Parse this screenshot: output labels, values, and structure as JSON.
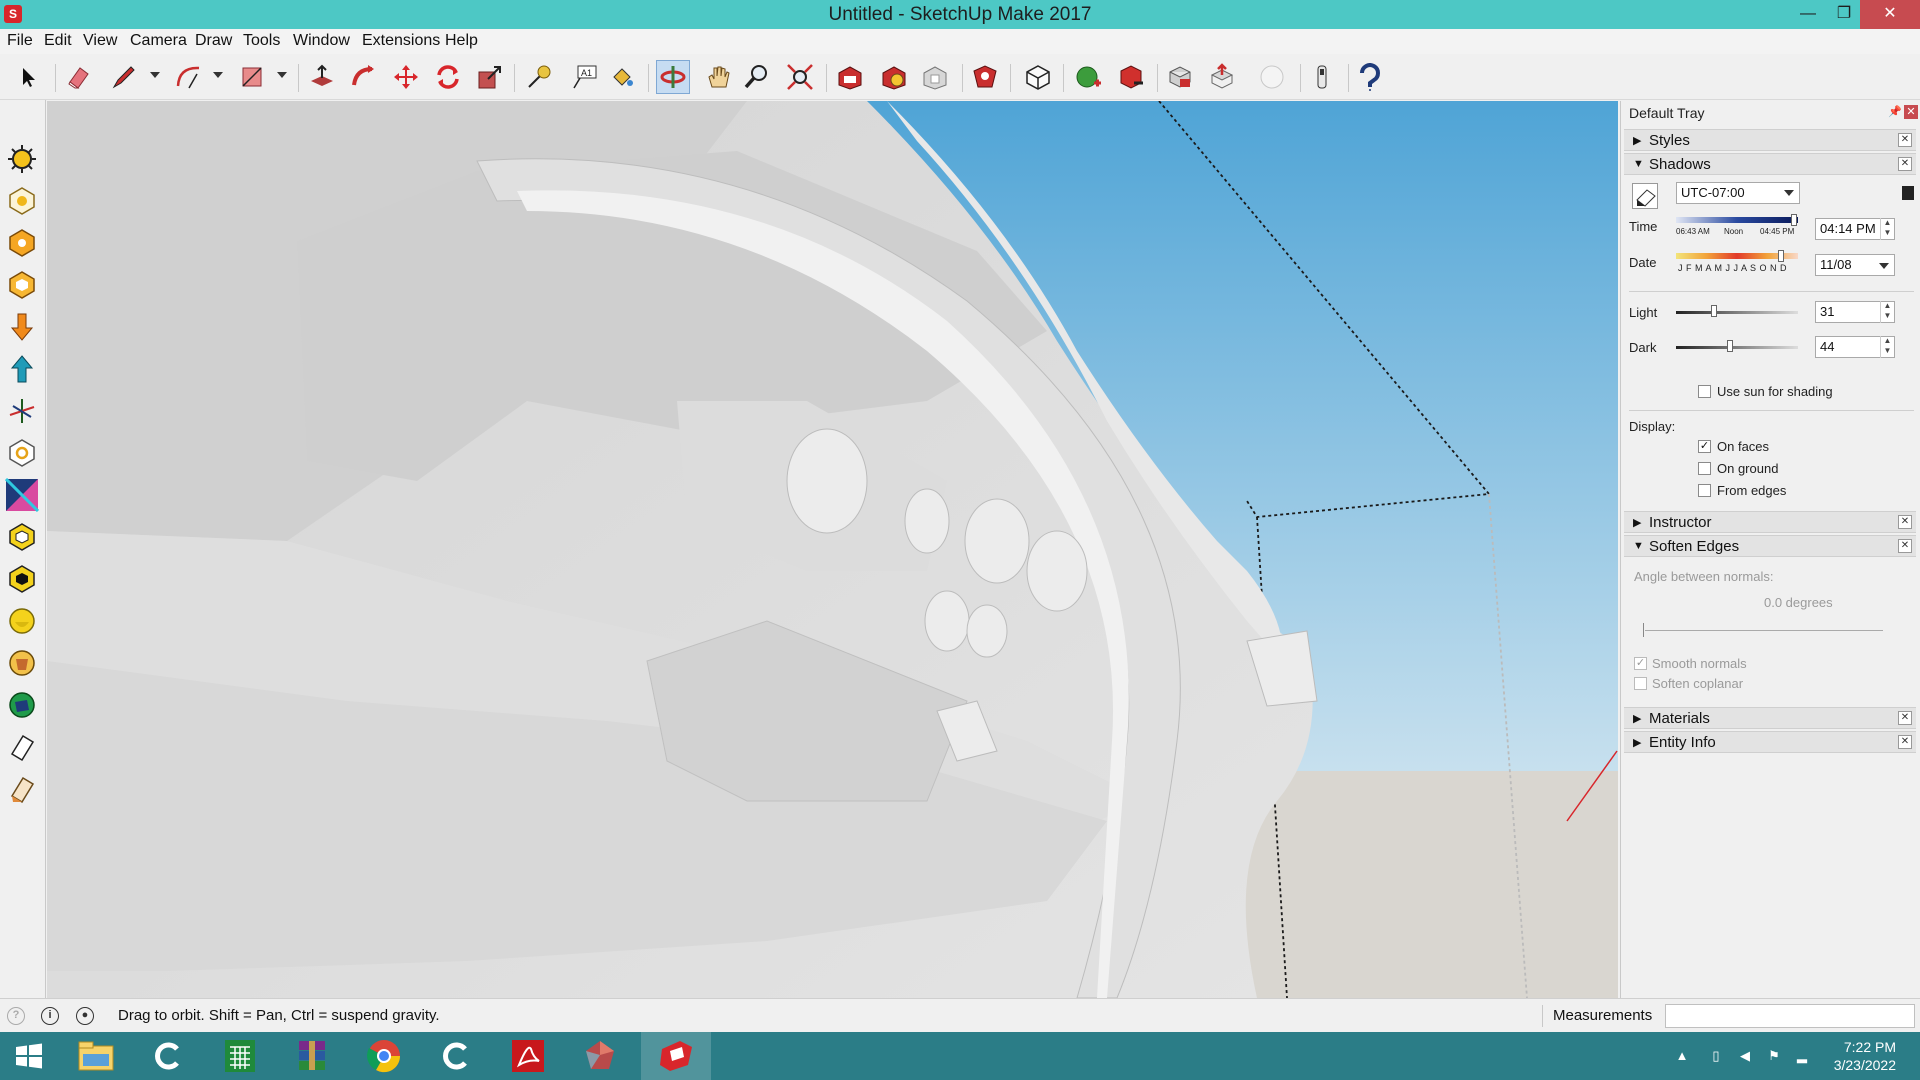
{
  "window": {
    "title": "Untitled - SketchUp Make 2017",
    "app_icon": "sketchup-logo-icon",
    "minimize": "—",
    "maximize": "❐",
    "close": "✕"
  },
  "menu": [
    "File",
    "Edit",
    "View",
    "Camera",
    "Draw",
    "Tools",
    "Window",
    "Extensions",
    "Help"
  ],
  "toolbar": {
    "active_tool": "orbit",
    "tools": [
      "select",
      "eraser",
      "line",
      "arc",
      "rectangle",
      "push-pull",
      "follow-me",
      "move",
      "rotate",
      "scale",
      "tape-measure",
      "text",
      "paint-bucket",
      "orbit",
      "pan",
      "zoom",
      "zoom-extents",
      "get-models",
      "share-model",
      "share-component",
      "extension-warehouse",
      "components",
      "add-location",
      "toggle-terrain",
      "photo-textures",
      "preview-model",
      "sandbox",
      "geo",
      "help"
    ]
  },
  "left_tools": [
    "sun-icon",
    "shadow-section-icon",
    "shadow-orange-icon",
    "hexagon-icon",
    "arrow-down-icon",
    "arrow-up-icon",
    "axis-icon",
    "ring-icon",
    "section-plane-icon",
    "hex-outline-icon",
    "hex-black-icon",
    "hex-yellow-icon",
    "shield-icon",
    "globe-icon",
    "eraser-small-icon",
    "pencil-small-icon"
  ],
  "tray": {
    "title": "Default Tray",
    "panels": {
      "styles": "Styles",
      "shadows": "Shadows",
      "instructor": "Instructor",
      "soften_edges": "Soften Edges",
      "materials": "Materials",
      "entity_info": "Entity Info"
    },
    "shadows": {
      "timezone": "UTC-07:00",
      "time_label": "Time",
      "time_ticks": [
        "06:43 AM",
        "Noon",
        "04:45 PM"
      ],
      "time_value": "04:14 PM",
      "date_label": "Date",
      "date_ticks": "J F M A M J J A S O N D",
      "date_value": "11/08",
      "light_label": "Light",
      "light_value": "31",
      "light_level": 0.31,
      "dark_label": "Dark",
      "dark_value": "44",
      "dark_level": 0.44,
      "use_sun_label": "Use sun for shading",
      "use_sun_checked": false,
      "display_label": "Display:",
      "on_faces_label": "On faces",
      "on_faces_checked": true,
      "on_ground_label": "On ground",
      "on_ground_checked": false,
      "from_edges_label": "From edges",
      "from_edges_checked": false
    },
    "soften": {
      "angle_label": "Angle between normals:",
      "angle_value": "0.0  degrees",
      "smooth_label": "Smooth normals",
      "smooth_checked": true,
      "coplanar_label": "Soften coplanar",
      "coplanar_checked": false
    }
  },
  "status": {
    "hint": "Drag to orbit. Shift = Pan, Ctrl = suspend gravity.",
    "measurements_label": "Measurements",
    "measurements_value": ""
  },
  "taskbar": {
    "apps": [
      "start",
      "file-explorer",
      "ccleaner",
      "spreadsheet",
      "winrar",
      "chrome",
      "ccleaner-2",
      "acrobat",
      "gem",
      "sketchup"
    ],
    "active_app": "sketchup",
    "time": "7:22 PM",
    "date": "3/23/2022"
  },
  "colors": {
    "titlebar": "#4dc8c5",
    "taskbar": "#2b7d87",
    "sky_top": "#4fa4d6",
    "sky_bottom": "#c7e0ee",
    "ground": "#d9d6d0",
    "model": "#dcdcdc",
    "close_button": "#c74b50"
  }
}
